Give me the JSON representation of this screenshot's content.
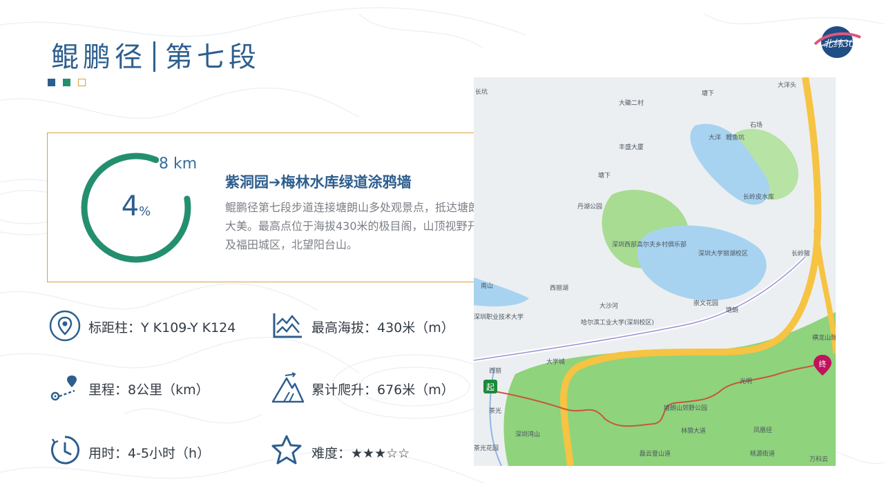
{
  "header": {
    "title_main": "鲲鹏径",
    "title_section": "第七段",
    "logo_text": "北纬30"
  },
  "colors": {
    "primary": "#2d5e8e",
    "accent_green": "#248f6f",
    "accent_gold": "#d6a23b",
    "map_green": "#8fd37c",
    "map_road": "#f6c343"
  },
  "segment": {
    "progress_percent": 4,
    "distance_label": "8 km",
    "percent_value": "4",
    "percent_unit": "%",
    "route_title": "紫洞园➔梅林水库绿道涂鸦墙",
    "description": "鲲鹏径第七段步道连接塘朗山多处观景点，抵达塘朗山顶峰俯瞰南山大美。最高点位于海拔430米的极目阁，山顶视野开阔，可俯瞰南山及福田城区，北望阳台山。"
  },
  "stats": {
    "markers": "标距柱：Y K109-Y K124",
    "distance": "里程：8公里（km）",
    "duration": "用时：4-5小时（h）",
    "max_altitude": "最高海拔：430米（m）",
    "total_climb": "累计爬升：676米（m）",
    "difficulty": "难度：★★★☆☆"
  },
  "icons": {
    "markers": "map-pin-icon",
    "distance": "route-icon",
    "duration": "clock-icon",
    "altitude": "altitude-chart-icon",
    "climb": "mountain-icon",
    "difficulty": "star-icon"
  },
  "map": {
    "start_label": "起",
    "end_label": "终",
    "labels": [
      "长坑",
      "大磡二村",
      "大洋头",
      "塘下",
      "石场",
      "大洋",
      "鲤鱼坑",
      "丰盛大厦",
      "塘下",
      "丹湖公园",
      "长岭皮水库",
      "深圳西部高尔夫乡村俱乐部",
      "深圳大学丽湖校区",
      "崇文花园",
      "南山",
      "大沙河",
      "西丽湖",
      "哈尔滨工业大学(深圳校区)",
      "深圳职业技术大学",
      "大学城",
      "西丽",
      "茶光",
      "深圳湾山",
      "塘朗山郊野公园",
      "光明",
      "凤凰径",
      "磊云登山道",
      "林荫大道",
      "桃源街道",
      "长岭陂",
      "塘朗",
      "横龙山隧道",
      "万科云",
      "茶光花园"
    ]
  }
}
